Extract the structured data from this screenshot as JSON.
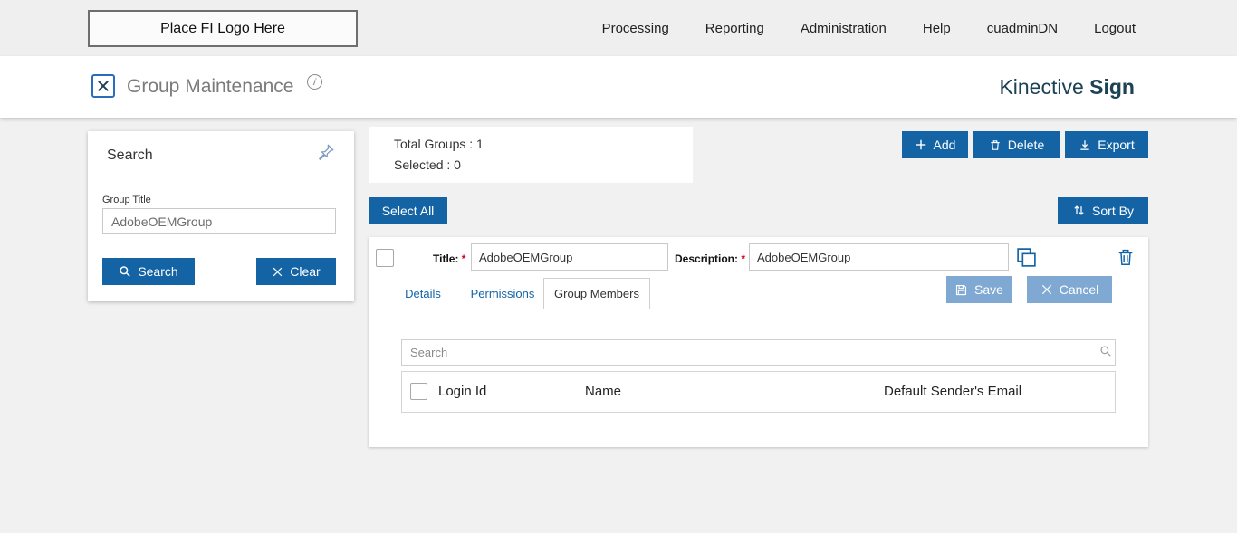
{
  "topbar": {
    "logo_placeholder": "Place FI Logo Here",
    "nav": [
      {
        "label": "Processing"
      },
      {
        "label": "Reporting"
      },
      {
        "label": "Administration"
      },
      {
        "label": "Help"
      },
      {
        "label": "cuadminDN"
      },
      {
        "label": "Logout"
      }
    ]
  },
  "header": {
    "title": "Group Maintenance",
    "info_icon": "i",
    "brand_name": "Kinective ",
    "brand_bold": "Sign"
  },
  "search_panel": {
    "title": "Search",
    "group_title_label": "Group Title",
    "group_title_value": "AdobeOEMGroup",
    "search_button": "Search",
    "clear_button": "Clear"
  },
  "summary": {
    "total_groups": "Total Groups : 1",
    "selected": "Selected : 0"
  },
  "toolbar": {
    "add": "Add",
    "delete": "Delete",
    "export": "Export",
    "select_all": "Select All",
    "sort_by": "Sort By"
  },
  "group_row": {
    "title_label": "Title:",
    "title_required": "*",
    "title_value": "AdobeOEMGroup",
    "description_label": "Description:",
    "description_required": "*",
    "description_value": "AdobeOEMGroup",
    "tabs": [
      {
        "label": "Details",
        "active": false
      },
      {
        "label": "Permissions",
        "active": false
      },
      {
        "label": "Group Members",
        "active": true
      }
    ],
    "save_button": "Save",
    "cancel_button": "Cancel"
  },
  "members": {
    "search_placeholder": "Search",
    "columns": [
      "Login Id",
      "Name",
      "Default Sender's Email"
    ],
    "rows": []
  },
  "colors": {
    "accent": "#1464A5",
    "muted_action": "#7FA8D2",
    "brand_text": "#1C4254",
    "topbar_bg": "#EFEFEF"
  }
}
